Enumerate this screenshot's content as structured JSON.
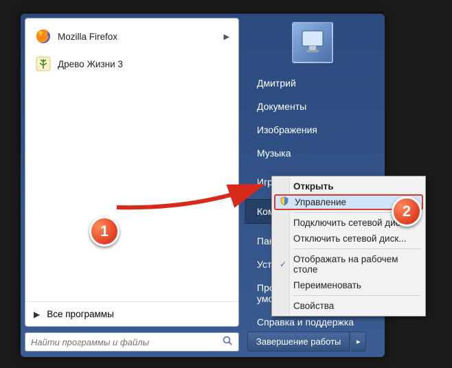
{
  "left": {
    "recent": [
      {
        "label": "Mozilla Firefox",
        "icon": "firefox",
        "hasSubmenu": true
      },
      {
        "label": "Древо Жизни 3",
        "icon": "tree",
        "hasSubmenu": false
      }
    ],
    "allPrograms": "Все программы",
    "searchPlaceholder": "Найти программы и файлы"
  },
  "right": {
    "items": [
      "Дмитрий",
      "Документы",
      "Изображения",
      "Музыка",
      "Игры",
      "Компьютер",
      "Панель управления",
      "Устройства и принтеры",
      "Программы по умолчанию",
      "Справка и поддержка"
    ],
    "activeIndex": 5
  },
  "shutdown": {
    "label": "Завершение работы"
  },
  "contextMenu": {
    "items": [
      {
        "label": "Открыть",
        "bold": true
      },
      {
        "label": "Управление",
        "highlight": true,
        "icon": "shield"
      },
      {
        "label": "Подключить сетевой диск...",
        "sepBefore": true
      },
      {
        "label": "Отключить сетевой диск..."
      },
      {
        "label": "Отображать на рабочем столе",
        "sepBefore": true,
        "check": true
      },
      {
        "label": "Переименовать"
      },
      {
        "label": "Свойства",
        "sepBefore": true
      }
    ]
  },
  "badges": {
    "one": "1",
    "two": "2"
  }
}
